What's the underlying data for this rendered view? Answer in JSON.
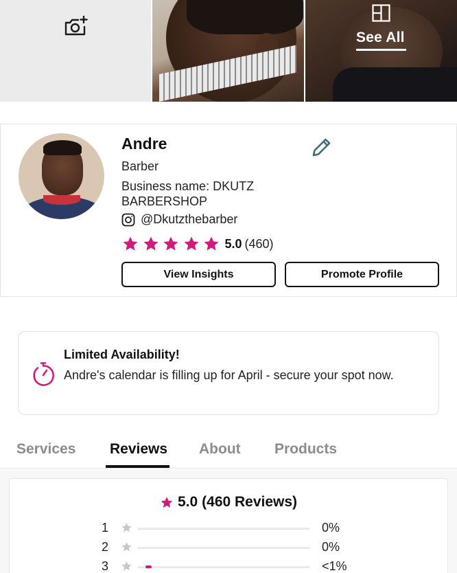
{
  "gallery": {
    "see_all_label": "See All"
  },
  "profile": {
    "name": "Andre",
    "role": "Barber",
    "business": "Business name: DKUTZ BARBERSHOP",
    "instagram": "@Dkutzthebarber",
    "rating_score": "5.0",
    "rating_count": "(460)",
    "stars": 5,
    "view_insights_label": "View Insights",
    "promote_profile_label": "Promote Profile"
  },
  "availability": {
    "title": "Limited Availability!",
    "text": "Andre's calendar is filling up for April - secure your spot now."
  },
  "tabs": [
    {
      "label": "Services"
    },
    {
      "label": "Reviews"
    },
    {
      "label": "About"
    },
    {
      "label": "Products"
    }
  ],
  "reviews": {
    "score": "5.0",
    "total": "(460 Reviews)",
    "distribution": [
      {
        "stars": "1",
        "percent": "0%",
        "fill": 0
      },
      {
        "stars": "2",
        "percent": "0%",
        "fill": 0
      },
      {
        "stars": "3",
        "percent": "<1%",
        "fill": 0.02
      }
    ]
  },
  "colors": {
    "accent_pink": "#d01b7d",
    "icon_teal": "#3e6b78",
    "star_grey": "#c7c7c7"
  },
  "icons": {
    "camera": "camera-plus-icon",
    "gallery": "grid-layout-icon",
    "edit": "pencil-icon",
    "instagram": "instagram-icon",
    "star": "star-icon",
    "timer": "timer-icon"
  }
}
